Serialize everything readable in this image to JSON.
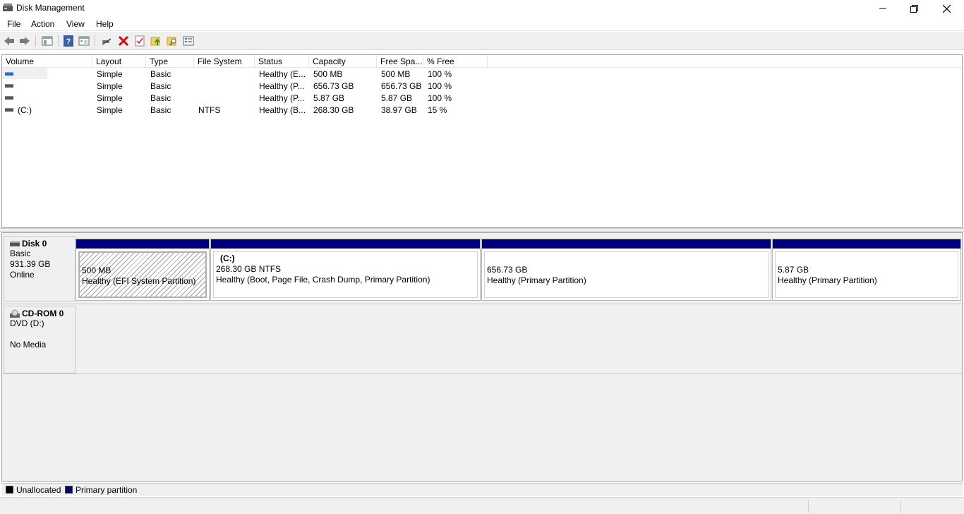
{
  "window": {
    "title": "Disk Management"
  },
  "menu": [
    "File",
    "Action",
    "View",
    "Help"
  ],
  "toolbar": [
    "back-icon",
    "forward-icon",
    "show-hide-tree-icon",
    "help-icon",
    "properties-icon",
    "connect-icon",
    "delete-icon",
    "check-icon",
    "up-folder-icon",
    "search-folder-icon",
    "list-view-icon"
  ],
  "volume_list": {
    "columns": [
      "Volume",
      "Layout",
      "Type",
      "File System",
      "Status",
      "Capacity",
      "Free Spa...",
      "% Free"
    ],
    "rows": [
      {
        "volume": "",
        "layout": "Simple",
        "type": "Basic",
        "fs": "",
        "status": "Healthy (E...",
        "capacity": "500 MB",
        "free": "500 MB",
        "pct": "100 %"
      },
      {
        "volume": "",
        "layout": "Simple",
        "type": "Basic",
        "fs": "",
        "status": "Healthy (P...",
        "capacity": "656.73 GB",
        "free": "656.73 GB",
        "pct": "100 %"
      },
      {
        "volume": "",
        "layout": "Simple",
        "type": "Basic",
        "fs": "",
        "status": "Healthy (P...",
        "capacity": "5.87 GB",
        "free": "5.87 GB",
        "pct": "100 %"
      },
      {
        "volume": "(C:)",
        "layout": "Simple",
        "type": "Basic",
        "fs": "NTFS",
        "status": "Healthy (B...",
        "capacity": "268.30 GB",
        "free": "38.97 GB",
        "pct": "15 %"
      }
    ]
  },
  "disks": [
    {
      "name": "Disk 0",
      "kind": "Basic",
      "size": "931.39 GB",
      "state": "Online",
      "partitions": [
        {
          "title": "",
          "size": "500 MB",
          "status": "Healthy (EFI System Partition)"
        },
        {
          "title": "(C:)",
          "size": "268.30 GB NTFS",
          "status": "Healthy (Boot, Page File, Crash Dump, Primary Partition)"
        },
        {
          "title": "",
          "size": "656.73 GB",
          "status": "Healthy (Primary Partition)"
        },
        {
          "title": "",
          "size": "5.87 GB",
          "status": "Healthy (Primary Partition)"
        }
      ]
    },
    {
      "name": "CD-ROM 0",
      "kind": "DVD (D:)",
      "state": "No Media"
    }
  ],
  "legend": [
    {
      "label": "Unallocated",
      "color": "#000000"
    },
    {
      "label": "Primary partition",
      "color": "#00007f"
    }
  ]
}
